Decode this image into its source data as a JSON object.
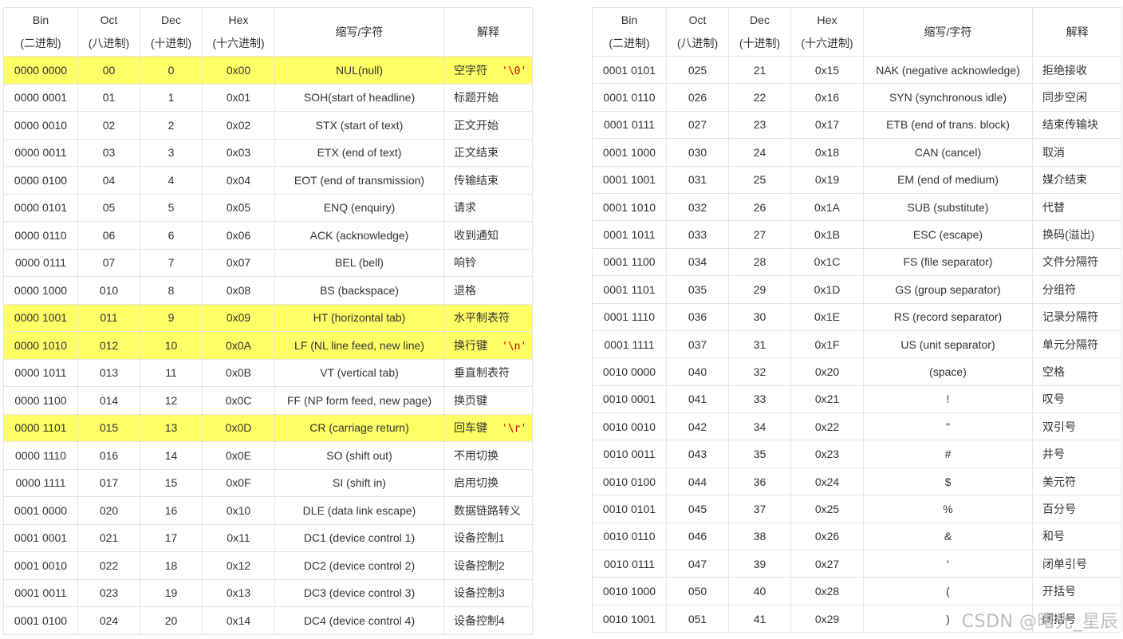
{
  "headers": {
    "bin": [
      "Bin",
      "(二进制)"
    ],
    "oct": [
      "Oct",
      "(八进制)"
    ],
    "dec": [
      "Dec",
      "(十进制)"
    ],
    "hex": [
      "Hex",
      "(十六进制)"
    ],
    "abbr": "缩写/字符",
    "expl": "解释"
  },
  "left_rows": [
    {
      "bin": "0000 0000",
      "oct": "00",
      "dec": "0",
      "hex": "0x00",
      "abbr": "NUL(null)",
      "expl": "空字符",
      "esc": "'\\0'",
      "highlight": true
    },
    {
      "bin": "0000 0001",
      "oct": "01",
      "dec": "1",
      "hex": "0x01",
      "abbr": "SOH(start of headline)",
      "expl": "标题开始"
    },
    {
      "bin": "0000 0010",
      "oct": "02",
      "dec": "2",
      "hex": "0x02",
      "abbr": "STX (start of text)",
      "expl": "正文开始"
    },
    {
      "bin": "0000 0011",
      "oct": "03",
      "dec": "3",
      "hex": "0x03",
      "abbr": "ETX (end of text)",
      "expl": "正文结束"
    },
    {
      "bin": "0000 0100",
      "oct": "04",
      "dec": "4",
      "hex": "0x04",
      "abbr": "EOT (end of transmission)",
      "expl": "传输结束"
    },
    {
      "bin": "0000 0101",
      "oct": "05",
      "dec": "5",
      "hex": "0x05",
      "abbr": "ENQ (enquiry)",
      "expl": "请求"
    },
    {
      "bin": "0000 0110",
      "oct": "06",
      "dec": "6",
      "hex": "0x06",
      "abbr": "ACK (acknowledge)",
      "expl": "收到通知"
    },
    {
      "bin": "0000 0111",
      "oct": "07",
      "dec": "7",
      "hex": "0x07",
      "abbr": "BEL (bell)",
      "expl": "响铃"
    },
    {
      "bin": "0000 1000",
      "oct": "010",
      "dec": "8",
      "hex": "0x08",
      "abbr": "BS (backspace)",
      "expl": "退格"
    },
    {
      "bin": "0000 1001",
      "oct": "011",
      "dec": "9",
      "hex": "0x09",
      "abbr": "HT (horizontal tab)",
      "expl": "水平制表符",
      "highlight": true
    },
    {
      "bin": "0000 1010",
      "oct": "012",
      "dec": "10",
      "hex": "0x0A",
      "abbr": "LF (NL line feed, new line)",
      "expl": "换行键",
      "esc": "'\\n'",
      "highlight": true
    },
    {
      "bin": "0000 1011",
      "oct": "013",
      "dec": "11",
      "hex": "0x0B",
      "abbr": "VT (vertical tab)",
      "expl": "垂直制表符"
    },
    {
      "bin": "0000 1100",
      "oct": "014",
      "dec": "12",
      "hex": "0x0C",
      "abbr": "FF (NP form feed, new page)",
      "expl": "换页键"
    },
    {
      "bin": "0000 1101",
      "oct": "015",
      "dec": "13",
      "hex": "0x0D",
      "abbr": "CR (carriage return)",
      "expl": "回车键",
      "esc": "'\\r'",
      "highlight": true
    },
    {
      "bin": "0000 1110",
      "oct": "016",
      "dec": "14",
      "hex": "0x0E",
      "abbr": "SO (shift out)",
      "expl": "不用切换"
    },
    {
      "bin": "0000 1111",
      "oct": "017",
      "dec": "15",
      "hex": "0x0F",
      "abbr": "SI (shift in)",
      "expl": "启用切换"
    },
    {
      "bin": "0001 0000",
      "oct": "020",
      "dec": "16",
      "hex": "0x10",
      "abbr": "DLE (data link escape)",
      "expl": "数据链路转义"
    },
    {
      "bin": "0001 0001",
      "oct": "021",
      "dec": "17",
      "hex": "0x11",
      "abbr": "DC1 (device control 1)",
      "expl": "设备控制1"
    },
    {
      "bin": "0001 0010",
      "oct": "022",
      "dec": "18",
      "hex": "0x12",
      "abbr": "DC2 (device control 2)",
      "expl": "设备控制2"
    },
    {
      "bin": "0001 0011",
      "oct": "023",
      "dec": "19",
      "hex": "0x13",
      "abbr": "DC3 (device control 3)",
      "expl": "设备控制3"
    },
    {
      "bin": "0001 0100",
      "oct": "024",
      "dec": "20",
      "hex": "0x14",
      "abbr": "DC4 (device control 4)",
      "expl": "设备控制4"
    }
  ],
  "right_rows": [
    {
      "bin": "0001 0101",
      "oct": "025",
      "dec": "21",
      "hex": "0x15",
      "abbr": "NAK (negative acknowledge)",
      "expl": "拒绝接收"
    },
    {
      "bin": "0001 0110",
      "oct": "026",
      "dec": "22",
      "hex": "0x16",
      "abbr": "SYN (synchronous idle)",
      "expl": "同步空闲"
    },
    {
      "bin": "0001 0111",
      "oct": "027",
      "dec": "23",
      "hex": "0x17",
      "abbr": "ETB (end of trans. block)",
      "expl": "结束传输块"
    },
    {
      "bin": "0001 1000",
      "oct": "030",
      "dec": "24",
      "hex": "0x18",
      "abbr": "CAN (cancel)",
      "expl": "取消"
    },
    {
      "bin": "0001 1001",
      "oct": "031",
      "dec": "25",
      "hex": "0x19",
      "abbr": "EM (end of medium)",
      "expl": "媒介结束"
    },
    {
      "bin": "0001 1010",
      "oct": "032",
      "dec": "26",
      "hex": "0x1A",
      "abbr": "SUB (substitute)",
      "expl": "代替"
    },
    {
      "bin": "0001 1011",
      "oct": "033",
      "dec": "27",
      "hex": "0x1B",
      "abbr": "ESC (escape)",
      "expl": "换码(溢出)"
    },
    {
      "bin": "0001 1100",
      "oct": "034",
      "dec": "28",
      "hex": "0x1C",
      "abbr": "FS (file separator)",
      "expl": "文件分隔符"
    },
    {
      "bin": "0001 1101",
      "oct": "035",
      "dec": "29",
      "hex": "0x1D",
      "abbr": "GS (group separator)",
      "expl": "分组符"
    },
    {
      "bin": "0001 1110",
      "oct": "036",
      "dec": "30",
      "hex": "0x1E",
      "abbr": "RS (record separator)",
      "expl": "记录分隔符"
    },
    {
      "bin": "0001 1111",
      "oct": "037",
      "dec": "31",
      "hex": "0x1F",
      "abbr": "US (unit separator)",
      "expl": "单元分隔符"
    },
    {
      "bin": "0010 0000",
      "oct": "040",
      "dec": "32",
      "hex": "0x20",
      "abbr": "(space)",
      "expl": "空格"
    },
    {
      "bin": "0010 0001",
      "oct": "041",
      "dec": "33",
      "hex": "0x21",
      "abbr": "!",
      "expl": "叹号"
    },
    {
      "bin": "0010 0010",
      "oct": "042",
      "dec": "34",
      "hex": "0x22",
      "abbr": "\"",
      "expl": "双引号"
    },
    {
      "bin": "0010 0011",
      "oct": "043",
      "dec": "35",
      "hex": "0x23",
      "abbr": "#",
      "expl": "井号"
    },
    {
      "bin": "0010 0100",
      "oct": "044",
      "dec": "36",
      "hex": "0x24",
      "abbr": "$",
      "expl": "美元符"
    },
    {
      "bin": "0010 0101",
      "oct": "045",
      "dec": "37",
      "hex": "0x25",
      "abbr": "%",
      "expl": "百分号"
    },
    {
      "bin": "0010 0110",
      "oct": "046",
      "dec": "38",
      "hex": "0x26",
      "abbr": "&",
      "expl": "和号"
    },
    {
      "bin": "0010 0111",
      "oct": "047",
      "dec": "39",
      "hex": "0x27",
      "abbr": "'",
      "expl": "闭单引号"
    },
    {
      "bin": "0010 1000",
      "oct": "050",
      "dec": "40",
      "hex": "0x28",
      "abbr": "(",
      "expl": "开括号"
    },
    {
      "bin": "0010 1001",
      "oct": "051",
      "dec": "41",
      "hex": "0x29",
      "abbr": ")",
      "expl": "闭括号"
    }
  ],
  "watermark": "CSDN @曙光_星辰",
  "colors": {
    "highlight": "#ffff66",
    "escape_text": "#cc0000",
    "border": "#e4e4e4"
  }
}
